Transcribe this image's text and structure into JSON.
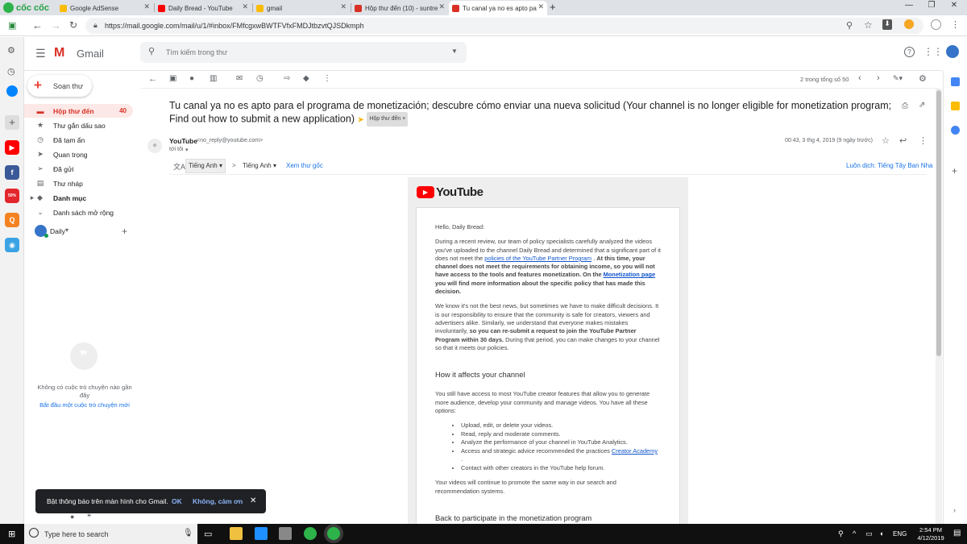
{
  "browser": {
    "brand": "cốc cốc",
    "tabs": [
      {
        "title": "Google AdSense",
        "color": "#fbbc04"
      },
      {
        "title": "Daily Bread - YouTube",
        "color": "#ff0000"
      },
      {
        "title": "gmail",
        "color": "#fbbc04"
      },
      {
        "title": "Hộp thư đến (10) - suntre",
        "color": "#d93025"
      },
      {
        "title": "Tu canal ya no es apto pa",
        "color": "#d93025"
      }
    ],
    "new_tab": "+",
    "url": "https://mail.google.com/mail/u/1/#inbox/FMfcgxwBWTFVfxFMDJtbzvtQJSDkmph"
  },
  "gmail": {
    "logo_text": "Gmail",
    "search_placeholder": "Tìm kiếm trong thư",
    "compose_label": "Soạn thư",
    "nav": [
      {
        "label": "Hộp thư đến",
        "count": "40",
        "icon": "▬",
        "active": true
      },
      {
        "label": "Thư gắn dấu sao",
        "count": "",
        "icon": "★"
      },
      {
        "label": "Đã tạm ẩn",
        "count": "",
        "icon": "◷"
      },
      {
        "label": "Quan trọng",
        "count": "",
        "icon": "➤"
      },
      {
        "label": "Đã gửi",
        "count": "",
        "icon": "➢"
      },
      {
        "label": "Thư nháp",
        "count": "",
        "icon": "▤"
      },
      {
        "label": "Danh mục",
        "count": "",
        "icon": "▸"
      },
      {
        "label": "Danh sách mở rộng",
        "count": "",
        "icon": "⌄"
      }
    ],
    "hangouts_user": "Daily",
    "hangouts_empty": "Không có cuộc trò chuyện nào gần đây",
    "hangouts_start": "Bắt đầu một cuộc trò chuyện mới",
    "pagination": "2 trong tổng số 50",
    "toast": {
      "message": "Bật thông báo trên màn hình cho Gmail.",
      "ok": "OK",
      "no": "Không, cảm ơn"
    }
  },
  "message": {
    "subject": "Tu canal ya no es apto para el programa de monetización; descubre cómo enviar una nueva solicitud (Your channel is no longer eligible for monetization program; Find out how to submit a new application)",
    "label_badge": "Hộp thư đến",
    "label_badge_x": "×",
    "sender_name": "YouTube",
    "sender_email": "<no_reply@youtube.com>",
    "to": "tới tôi",
    "date": "00:43, 3 thg 4, 2019 (9 ngày trước)",
    "translate_from": "Tiếng Anh",
    "translate_arrow": ">",
    "translate_to": "Tiếng Anh",
    "view_original": "Xem thư gốc",
    "always_translate": "Luôn dịch: Tiếng Tây Ban Nha"
  },
  "email": {
    "yt_logo_text": "YouTube",
    "greeting": "Hello, Daily Bread:",
    "p1_a": "During a recent review, our team of policy specialists carefully analyzed the videos you've uploaded to the channel Daily Bread and determined that a significant part of it does not meet the ",
    "p1_link": "policies of the YouTube Partner Program",
    "p1_b": " . ",
    "p1_bold_a": "At this time, your channel does not meet the requirements for obtaining income, so you will not have access to the tools and features monetization. On the ",
    "p1_link2": "Monetization page",
    "p1_bold_b": " you will find more information about the specific policy that has made this decision.",
    "p2_a": "We know it's not the best news, but sometimes we have to make difficult decisions. It is our responsibility to ensure that the community is safe for creators, viewers and advertisers alike. Similarly, we understand that everyone makes mistakes involuntarily, ",
    "p2_bold": "so you can re-submit a request to join the YouTube Partner Program within 30 days.",
    "p2_b": " During that period, you can make changes to your channel so that it meets our policies.",
    "h_affects": "How it affects your channel",
    "p3": "You still have access to most YouTube creator features that allow you to generate more audience, develop your community and manage videos. You have all these options:",
    "list": [
      "Upload, edit, or delete your videos.",
      "Read, reply and moderate comments.",
      "Analyze the performance of your channel in YouTube Analytics."
    ],
    "li4_a": "Access and strategic advice recommended the practices ",
    "li4_link": "Creator Academy",
    "li4_b": " .",
    "li5": "Contact with other creators in the YouTube help forum.",
    "p4": "Your videos will continue to promote the same way in our search and recommendation systems.",
    "h_back": "Back to participate in the monetization program"
  },
  "taskbar": {
    "search_placeholder": "Type here to search",
    "lang": "ENG",
    "time": "2:54 PM",
    "date": "4/12/2019"
  }
}
